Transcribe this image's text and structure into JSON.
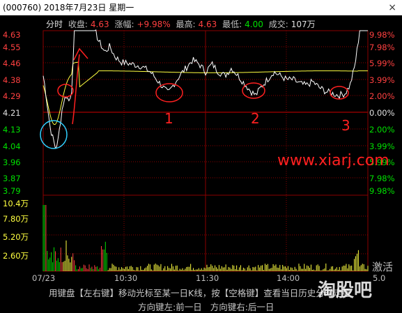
{
  "window": {
    "title": "(000760) 2018年7月23日 星期一",
    "close_glyph": "×"
  },
  "stats": {
    "chart_label": "分时",
    "close_label": "收盘:",
    "close_value": "4.63",
    "change_label": "涨幅:",
    "change_value": "+9.98%",
    "high_label": "最高:",
    "high_value": "4.63",
    "low_label": "最低:",
    "low_value": "4.00",
    "volume_label": "成交:",
    "volume_value": "107万"
  },
  "price_axis": {
    "left_ticks": [
      "4.63",
      "4.55",
      "4.46",
      "4.38",
      "4.29",
      "4.21",
      "4.13",
      "4.04",
      "3.96",
      "3.87",
      "3.79"
    ],
    "right_ticks": [
      "9.98%",
      "7.98%",
      "5.99%",
      "3.99%",
      "2.00%",
      "0.00%",
      "2.00%",
      "3.99%",
      "5.99%",
      "7.98%",
      "9.98%"
    ],
    "prev_close": "4.21"
  },
  "volume_axis": {
    "ticks": [
      "10.4万",
      "7.80万",
      "5.20万",
      "2.60万"
    ],
    "right_end_label": "5.0"
  },
  "time_axis": {
    "ticks": [
      "07/23",
      "10:30",
      "11:30",
      "14:00"
    ]
  },
  "colors": {
    "up": "#ff4040",
    "down": "#00e000",
    "flat": "#e0e0e0",
    "price_line": "#ffffff",
    "avg_line": "#ffff40",
    "grid": "#8b0000",
    "volume": "#ffff40"
  },
  "annotations": {
    "marks": [
      "1",
      "2",
      "3"
    ],
    "watermark": "www.xiarj.com"
  },
  "footer": {
    "line1": "用键盘【左右键】移动光标至某一日K线，按【空格键】查看当日历史分时走势",
    "line2_left": "方向键左:前一日",
    "line2_right": "方向键右:后一日"
  },
  "overlay": {
    "activate": "激活",
    "logo": "淘股吧"
  }
}
